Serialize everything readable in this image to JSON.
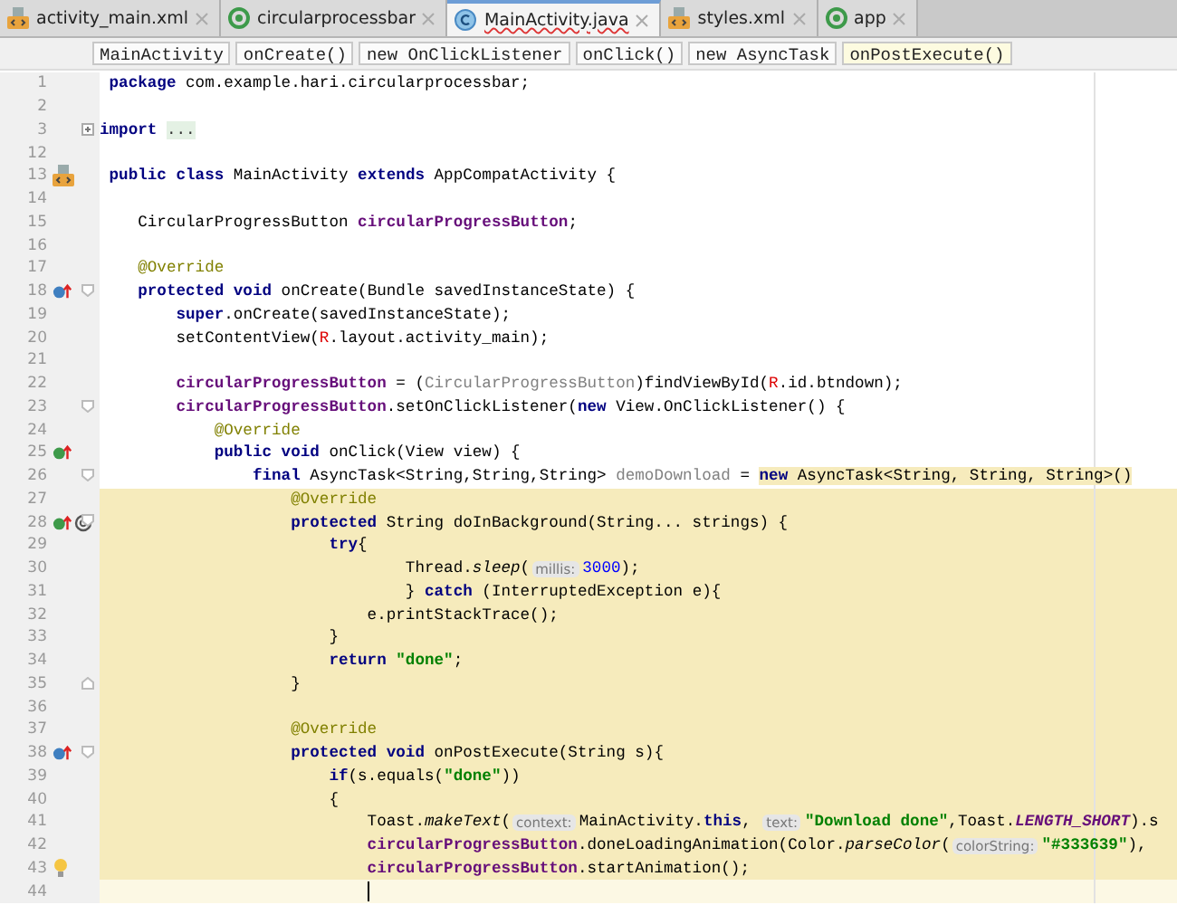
{
  "tabs": [
    {
      "label": "activity_main.xml",
      "kind": "xml",
      "selected": false
    },
    {
      "label": "circularprocessbar",
      "kind": "module",
      "selected": false
    },
    {
      "label": "MainActivity.java",
      "kind": "class",
      "selected": true
    },
    {
      "label": "styles.xml",
      "kind": "xml",
      "selected": false
    },
    {
      "label": "app",
      "kind": "module",
      "selected": false
    }
  ],
  "breadcrumbs": [
    {
      "label": "MainActivity",
      "selected": false
    },
    {
      "label": "onCreate()",
      "selected": false
    },
    {
      "label": "new OnClickListener",
      "selected": false
    },
    {
      "label": "onClick()",
      "selected": false
    },
    {
      "label": "new AsyncTask",
      "selected": false
    },
    {
      "label": "onPostExecute()",
      "selected": true
    }
  ],
  "lines": [
    {
      "number": "1",
      "tokens": [
        {
          "kind": "kw",
          "text": " package"
        },
        {
          "kind": "plain",
          "text": " com.example.hari.circularprocessbar;"
        }
      ]
    },
    {
      "number": "2"
    },
    {
      "number": "3",
      "fold": {
        "kind": "collapsed"
      },
      "tokens": [
        {
          "kind": "kw",
          "text": "import "
        },
        {
          "kind": "folded",
          "text": "..."
        }
      ]
    },
    {
      "number": "12"
    },
    {
      "number": "13",
      "gutter": [
        {
          "kind": "class"
        }
      ],
      "tokens": [
        {
          "kind": "kw",
          "text": " public class"
        },
        {
          "kind": "plain",
          "text": " MainActivity "
        },
        {
          "kind": "kw",
          "text": "extends"
        },
        {
          "kind": "plain",
          "text": " AppCompatActivity {"
        }
      ]
    },
    {
      "number": "14"
    },
    {
      "number": "15",
      "tokens": [
        {
          "kind": "plain",
          "text": "    CircularProgressButton "
        },
        {
          "kind": "field",
          "text": "circularProgressButton"
        },
        {
          "kind": "plain",
          "text": ";"
        }
      ]
    },
    {
      "number": "16"
    },
    {
      "number": "17",
      "tokens": [
        {
          "kind": "ann",
          "text": "    @Override"
        }
      ]
    },
    {
      "number": "18",
      "gutter": [
        {
          "kind": "override"
        }
      ],
      "fold": {
        "kind": "open"
      },
      "tokens": [
        {
          "kind": "kw",
          "text": "    protected void"
        },
        {
          "kind": "plain",
          "text": " onCreate(Bundle savedInstanceState) {"
        }
      ]
    },
    {
      "number": "19",
      "tokens": [
        {
          "kind": "kw",
          "text": "        super"
        },
        {
          "kind": "plain",
          "text": ".onCreate(savedInstanceState);"
        }
      ]
    },
    {
      "number": "20",
      "tokens": [
        {
          "kind": "plain",
          "text": "        setContentView("
        },
        {
          "kind": "red",
          "text": "R"
        },
        {
          "kind": "plain",
          "text": ".layout.activity_main);"
        }
      ]
    },
    {
      "number": "21"
    },
    {
      "number": "22",
      "tokens": [
        {
          "kind": "field",
          "text": "        circularProgressButton"
        },
        {
          "kind": "plain",
          "text": " = ("
        },
        {
          "kind": "grey",
          "text": "CircularProgressButton"
        },
        {
          "kind": "plain",
          "text": ")findViewById("
        },
        {
          "kind": "red",
          "text": "R"
        },
        {
          "kind": "plain",
          "text": ".id.btndown);"
        }
      ]
    },
    {
      "number": "23",
      "fold": {
        "kind": "open"
      },
      "tokens": [
        {
          "kind": "field",
          "text": "        circularProgressButton"
        },
        {
          "kind": "plain",
          "text": ".setOnClickListener("
        },
        {
          "kind": "kw",
          "text": "new"
        },
        {
          "kind": "plain",
          "text": " View.OnClickListener() {"
        }
      ]
    },
    {
      "number": "24",
      "tokens": [
        {
          "kind": "ann",
          "text": "            @Override"
        }
      ]
    },
    {
      "number": "25",
      "gutter": [
        {
          "kind": "implements"
        }
      ],
      "tokens": [
        {
          "kind": "kw",
          "text": "            public void"
        },
        {
          "kind": "plain",
          "text": " onClick(View view) {"
        }
      ]
    },
    {
      "number": "26",
      "fold": {
        "kind": "open"
      },
      "tokens": [
        {
          "kind": "kw",
          "text": "                final"
        },
        {
          "kind": "plain",
          "text": " AsyncTask<String,String,String> "
        },
        {
          "kind": "grey",
          "text": "demoDownload"
        },
        {
          "kind": "plain",
          "text": " = "
        },
        {
          "kind": "kw",
          "text": "new",
          "highlighted": true
        },
        {
          "kind": "plain",
          "text": " AsyncTask<String, String, String>()",
          "highlighted": true
        }
      ]
    },
    {
      "number": "27",
      "highlighted": true,
      "tokens": [
        {
          "kind": "ann",
          "text": "                    @Override"
        }
      ]
    },
    {
      "number": "28",
      "highlighted": true,
      "gutter": [
        {
          "kind": "implements"
        },
        {
          "kind": "at"
        }
      ],
      "fold": {
        "kind": "open"
      },
      "tokens": [
        {
          "kind": "kw",
          "text": "                    protected"
        },
        {
          "kind": "plain",
          "text": " String doInBackground(String... strings) {"
        }
      ]
    },
    {
      "number": "29",
      "highlighted": true,
      "tokens": [
        {
          "kind": "kw",
          "text": "                        try"
        },
        {
          "kind": "plain",
          "text": "{"
        }
      ]
    },
    {
      "number": "30",
      "highlighted": true,
      "tokens": [
        {
          "kind": "plain",
          "text": "                                Thread."
        },
        {
          "kind": "italic",
          "text": "sleep"
        },
        {
          "kind": "plain",
          "text": "("
        },
        {
          "kind": "hint",
          "text": "millis:"
        },
        {
          "kind": "num",
          "text": "3000"
        },
        {
          "kind": "plain",
          "text": ");"
        }
      ]
    },
    {
      "number": "31",
      "highlighted": true,
      "tokens": [
        {
          "kind": "plain",
          "text": "                                } "
        },
        {
          "kind": "kw",
          "text": "catch"
        },
        {
          "kind": "plain",
          "text": " (InterruptedException e){"
        }
      ]
    },
    {
      "number": "32",
      "highlighted": true,
      "tokens": [
        {
          "kind": "plain",
          "text": "                            e.printStackTrace();"
        }
      ]
    },
    {
      "number": "33",
      "highlighted": true,
      "tokens": [
        {
          "kind": "plain",
          "text": "                        }"
        }
      ]
    },
    {
      "number": "34",
      "highlighted": true,
      "tokens": [
        {
          "kind": "kw",
          "text": "                        return "
        },
        {
          "kind": "str",
          "text": "\"done\""
        },
        {
          "kind": "plain",
          "text": ";"
        }
      ]
    },
    {
      "number": "35",
      "highlighted": true,
      "fold": {
        "kind": "close"
      },
      "tokens": [
        {
          "kind": "plain",
          "text": "                    }"
        }
      ]
    },
    {
      "number": "36",
      "highlighted": true
    },
    {
      "number": "37",
      "highlighted": true,
      "tokens": [
        {
          "kind": "ann",
          "text": "                    @Override"
        }
      ]
    },
    {
      "number": "38",
      "highlighted": true,
      "gutter": [
        {
          "kind": "override"
        }
      ],
      "fold": {
        "kind": "open"
      },
      "tokens": [
        {
          "kind": "kw",
          "text": "                    protected void"
        },
        {
          "kind": "plain",
          "text": " onPostExecute(String s){"
        }
      ]
    },
    {
      "number": "39",
      "highlighted": true,
      "tokens": [
        {
          "kind": "kw",
          "text": "                        if"
        },
        {
          "kind": "plain",
          "text": "(s.equals("
        },
        {
          "kind": "str",
          "text": "\"done\""
        },
        {
          "kind": "plain",
          "text": "))"
        }
      ]
    },
    {
      "number": "40",
      "highlighted": true,
      "tokens": [
        {
          "kind": "plain",
          "text": "                        {"
        }
      ]
    },
    {
      "number": "41",
      "highlighted": true,
      "tokens": [
        {
          "kind": "plain",
          "text": "                            Toast."
        },
        {
          "kind": "italic",
          "text": "makeText"
        },
        {
          "kind": "plain",
          "text": "("
        },
        {
          "kind": "hint",
          "text": "context:"
        },
        {
          "kind": "plain",
          "text": "MainActivity."
        },
        {
          "kind": "kw",
          "text": "this"
        },
        {
          "kind": "plain",
          "text": ", "
        },
        {
          "kind": "hint",
          "text": "text:"
        },
        {
          "kind": "str",
          "text": "\"Download done\""
        },
        {
          "kind": "plain",
          "text": ",Toast."
        },
        {
          "kind": "fielditalic",
          "text": "LENGTH_SHORT"
        },
        {
          "kind": "plain",
          "text": ").s"
        }
      ]
    },
    {
      "number": "42",
      "highlighted": true,
      "tokens": [
        {
          "kind": "field",
          "text": "                            circularProgressButton"
        },
        {
          "kind": "plain",
          "text": ".doneLoadingAnimation(Color."
        },
        {
          "kind": "italic",
          "text": "parseColor"
        },
        {
          "kind": "plain",
          "text": "("
        },
        {
          "kind": "hint",
          "text": "colorString:"
        },
        {
          "kind": "str",
          "text": "\"#333639\""
        },
        {
          "kind": "plain",
          "text": "),"
        }
      ]
    },
    {
      "number": "43",
      "highlighted": true,
      "gutter": [
        {
          "kind": "bulb"
        }
      ],
      "tokens": [
        {
          "kind": "field",
          "text": "                            circularProgressButton"
        },
        {
          "kind": "plain",
          "text": ".startAnimation();"
        }
      ]
    },
    {
      "number": "44",
      "current": true,
      "cursor": true
    }
  ]
}
